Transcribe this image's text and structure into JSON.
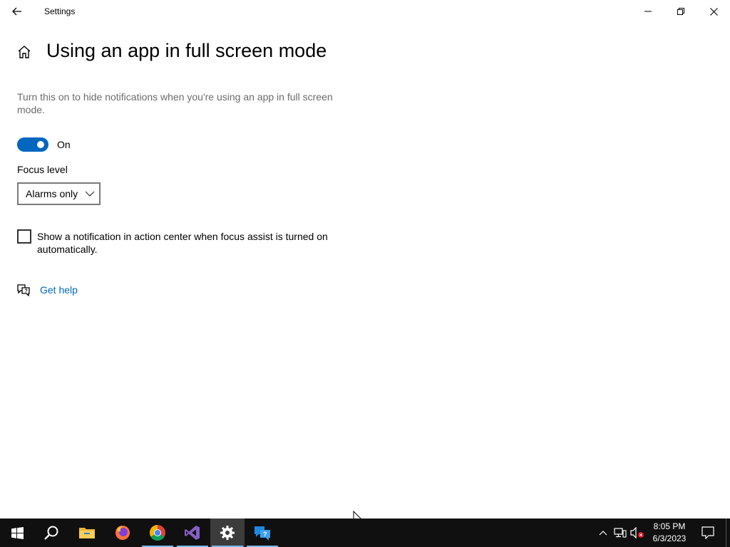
{
  "window": {
    "app_title": "Settings"
  },
  "page": {
    "title": "Using an app in full screen mode",
    "description": "Turn this on to hide notifications when you're using an app in full screen mode.",
    "toggle": {
      "label": "On",
      "state": "on",
      "color": "#0067c0"
    },
    "focus_level": {
      "label": "Focus level",
      "selected": "Alarms only"
    },
    "checkbox": {
      "label": "Show a notification in action center when focus assist is turned on automatically.",
      "checked": false
    },
    "help": {
      "label": "Get help",
      "icon": "chat-help-icon"
    }
  },
  "taskbar": {
    "items": [
      {
        "name": "start",
        "icon": "windows-logo-icon"
      },
      {
        "name": "search",
        "icon": "search-icon"
      },
      {
        "name": "file-explorer",
        "icon": "folder-icon"
      },
      {
        "name": "firefox",
        "icon": "firefox-icon"
      },
      {
        "name": "chrome",
        "icon": "chrome-icon"
      },
      {
        "name": "visual-studio",
        "icon": "visual-studio-icon"
      },
      {
        "name": "settings",
        "icon": "gear-icon",
        "active": true
      },
      {
        "name": "get-help",
        "icon": "help-app-icon"
      }
    ],
    "clock": {
      "time": "8:05 PM",
      "date": "6/3/2023"
    },
    "accent": "#76b9ed"
  }
}
